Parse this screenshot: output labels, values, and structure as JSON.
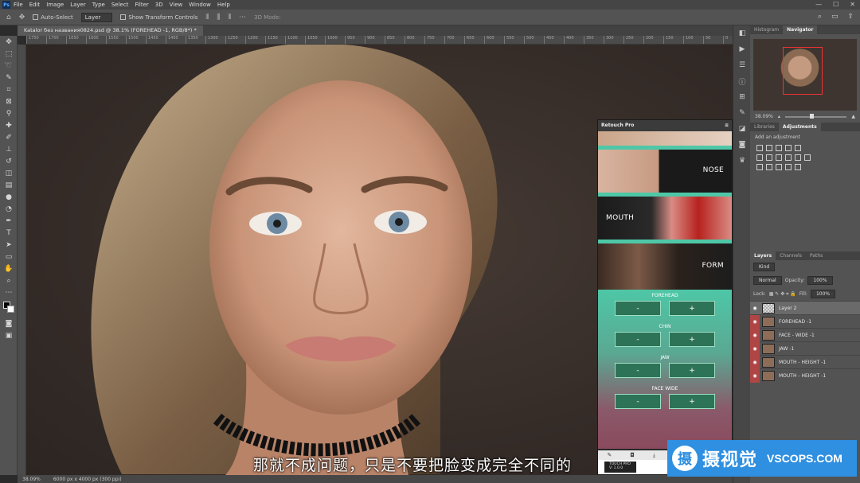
{
  "app": {
    "logo_label": "Ps",
    "colors": {
      "accent": "#4ec7a7",
      "brand_blue": "#2f8fe0",
      "selection": "#e33333"
    }
  },
  "menu": [
    "File",
    "Edit",
    "Image",
    "Layer",
    "Type",
    "Select",
    "Filter",
    "3D",
    "View",
    "Window",
    "Help"
  ],
  "window_controls": {
    "minimize": "—",
    "maximize": "☐",
    "close": "✕"
  },
  "options_bar": {
    "auto_select_label": "Auto-Select",
    "target_value": "Layer",
    "transform_label": "Show Transform Controls",
    "mode_label": "3D Mode:"
  },
  "document": {
    "tab_label": "Katalor без названия0824.psd @ 38.1% (FOREHEAD -1, RGB/8*) *"
  },
  "ruler_ticks": [
    "1750",
    "1700",
    "1650",
    "1600",
    "1550",
    "1500",
    "1450",
    "1400",
    "1350",
    "1300",
    "1250",
    "1200",
    "1150",
    "1100",
    "1050",
    "1000",
    "950",
    "900",
    "850",
    "800",
    "750",
    "700",
    "650",
    "600",
    "550",
    "500",
    "450",
    "400",
    "350",
    "300",
    "250",
    "200",
    "150",
    "100",
    "50",
    "0"
  ],
  "status": {
    "zoom": "38.09%",
    "doc_size": "6000 px x 4000 px (300 ppi)"
  },
  "navigator": {
    "tabs": [
      "Histogram",
      "Navigator"
    ],
    "zoom": "38.09%"
  },
  "adjustments": {
    "tabs": [
      "Libraries",
      "Adjustments"
    ],
    "add_label": "Add an adjustment"
  },
  "layers_panel": {
    "tabs": [
      "Layers",
      "Channels",
      "Paths"
    ],
    "kind_label": "Kind",
    "blend_mode": "Normal",
    "opacity_label": "Opacity:",
    "opacity_value": "100%",
    "lock_label": "Lock:",
    "fill_label": "Fill:",
    "fill_value": "100%",
    "layers": [
      {
        "name": "Layer 2",
        "selected": true
      },
      {
        "name": "FOREHEAD -1",
        "selected": false
      },
      {
        "name": "FACE - WIDE -1",
        "selected": false
      },
      {
        "name": "JAW -1",
        "selected": false
      },
      {
        "name": "MOUTH - HEIGHT -1",
        "selected": false
      },
      {
        "name": "MOUTH - HEIGHT -1",
        "selected": false
      }
    ]
  },
  "retouch_panel": {
    "title": "Retouch Pro",
    "features": [
      {
        "label": "NOSE"
      },
      {
        "label": "MOUTH"
      },
      {
        "label": "FORM"
      }
    ],
    "sections": [
      {
        "label": "FOREHEAD",
        "minus": "-",
        "plus": "+"
      },
      {
        "label": "CHIN",
        "minus": "-",
        "plus": "+"
      },
      {
        "label": "JAW",
        "minus": "-",
        "plus": "+"
      },
      {
        "label": "FACE WIDE",
        "minus": "-",
        "plus": "+"
      }
    ],
    "brand_line1": "TOUCH PRO",
    "brand_line2": "V: 1.0.0"
  },
  "subtitle": "那就不成问题，只是不要把脸变成完全不同的",
  "watermark": {
    "cn": "摄视觉",
    "en": "VSCOPS.COM",
    "logo_char": "摄"
  }
}
